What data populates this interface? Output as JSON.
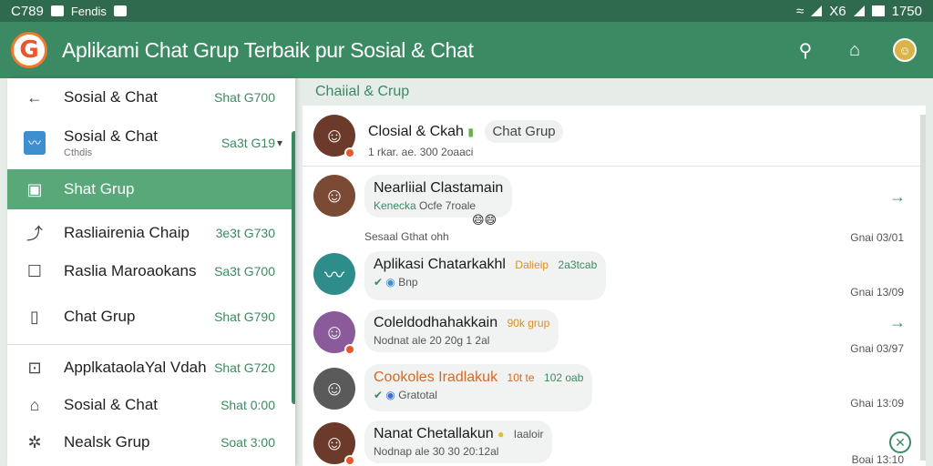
{
  "status_bar": {
    "left_text": "C789",
    "left_label": "Fendis",
    "right_text": "X6",
    "time": "1750"
  },
  "app_bar": {
    "logo_letter": "G",
    "title": "Aplikami Chat Grup Terbaik pur Sosial & Chat",
    "icons": [
      "search-icon",
      "home-icon",
      "profile-avatar"
    ]
  },
  "drawer": {
    "items": [
      {
        "label": "Sosial & Chat",
        "meta": "Shat G700",
        "icon": "back-arrow-icon",
        "sub": ""
      },
      {
        "label": "Sosial & Chat",
        "meta": "Sa3t G19",
        "icon": "wave-thumbnail",
        "sub": "Cthdis"
      },
      {
        "label": "Shat Grup",
        "meta": "",
        "icon": "square-icon",
        "sub": ""
      },
      {
        "label": "Rasliairenia Chaip",
        "meta": "3e3t G730",
        "icon": "share-icon",
        "sub": ""
      },
      {
        "label": "Raslia Maroaokans",
        "meta": "Sa3t G700",
        "icon": "checkbox-icon",
        "sub": ""
      },
      {
        "label": "Chat Grup",
        "meta": "Shat G790",
        "icon": "tablet-icon",
        "sub": ""
      },
      {
        "label": "ApplkataolaYal Vdah",
        "meta": "Shat G720",
        "icon": "square-dot-icon",
        "sub": ""
      },
      {
        "label": "Sosial & Chat",
        "meta": "Shat 0:00",
        "icon": "tag-icon",
        "sub": ""
      },
      {
        "label": "Nealsk Grup",
        "meta": "Soat 3:00",
        "icon": "gear-icon",
        "sub": ""
      }
    ]
  },
  "chat_panel": {
    "header": "Chaiial & Crup",
    "rows": [
      {
        "name": "Closial & Ckah",
        "tag": "Chat Grup",
        "sub": "1 rkar. ae. 300 2oaaci",
        "time": "",
        "arrow": ""
      },
      {
        "name": "Nearliial Clastamain",
        "sub_green": "Kenecka",
        "sub": "Ocfe 7roale",
        "extra": "Sesaal Gthat ohh",
        "time": "Gnai 03/01",
        "arrow": "→"
      },
      {
        "name": "Aplikasi Chatarkakhl",
        "tag_orange": "Dalieip",
        "tag_green": "2a3tcab",
        "sub": "Bnp",
        "time": "Gnai 13/09",
        "arrow": ""
      },
      {
        "name": "Coleldodhahakkain",
        "tag_orange": "90k grup",
        "sub": "Nodnat ale 20 20g 1 2al",
        "time": "Gnai 03/97",
        "arrow": "→"
      },
      {
        "name": "Cookoles Iradlakuk",
        "tag_orange": "10t te",
        "tag_green": "102 oab",
        "sub": "Gratotal",
        "time": "Ghai 13:09",
        "arrow": ""
      },
      {
        "name": "Nanat Chetallakun",
        "tag_grey": "Iaaloir",
        "sub": "Nodnap ale 30 30 20:12al",
        "time": "Boai 13:10",
        "arrow": ""
      }
    ]
  },
  "colors": {
    "primary": "#3c8a63",
    "status_bar": "#2f6a4e",
    "accent": "#e8562a",
    "active_item": "#59a87a"
  }
}
